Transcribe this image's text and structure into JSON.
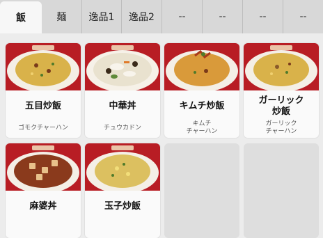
{
  "tabs": [
    {
      "label": "飯",
      "active": true
    },
    {
      "label": "麺",
      "active": false
    },
    {
      "label": "逸品1",
      "active": false
    },
    {
      "label": "逸品2",
      "active": false
    },
    {
      "label": "--",
      "active": false
    },
    {
      "label": "--",
      "active": false
    },
    {
      "label": "--",
      "active": false
    },
    {
      "label": "--",
      "active": false
    }
  ],
  "menu": [
    {
      "name": "五目炒飯",
      "kana": "ゴモクチャーハン",
      "image": "fried-rice"
    },
    {
      "name": "中華丼",
      "kana": "チュウカドン",
      "image": "chukadon"
    },
    {
      "name": "キムチ炒飯",
      "kana": "キムチ\nチャーハン",
      "image": "kimchi-fried-rice"
    },
    {
      "name": "ガーリック\n炒飯",
      "kana": "ガーリック\nチャーハン",
      "image": "garlic-fried-rice"
    },
    {
      "name": "麻婆丼",
      "kana": "",
      "image": "mabo-don"
    },
    {
      "name": "玉子炒飯",
      "kana": "",
      "image": "egg-fried-rice"
    },
    {
      "name": "",
      "kana": "",
      "image": "empty"
    },
    {
      "name": "",
      "kana": "",
      "image": "empty"
    }
  ],
  "colors": {
    "plate_rim": "#c8232b",
    "fried_rice": "#d9b24a",
    "kimchi_rice": "#d99a3a",
    "chukadon": "#e9e2cf",
    "mabo": "#8a3a1c"
  }
}
